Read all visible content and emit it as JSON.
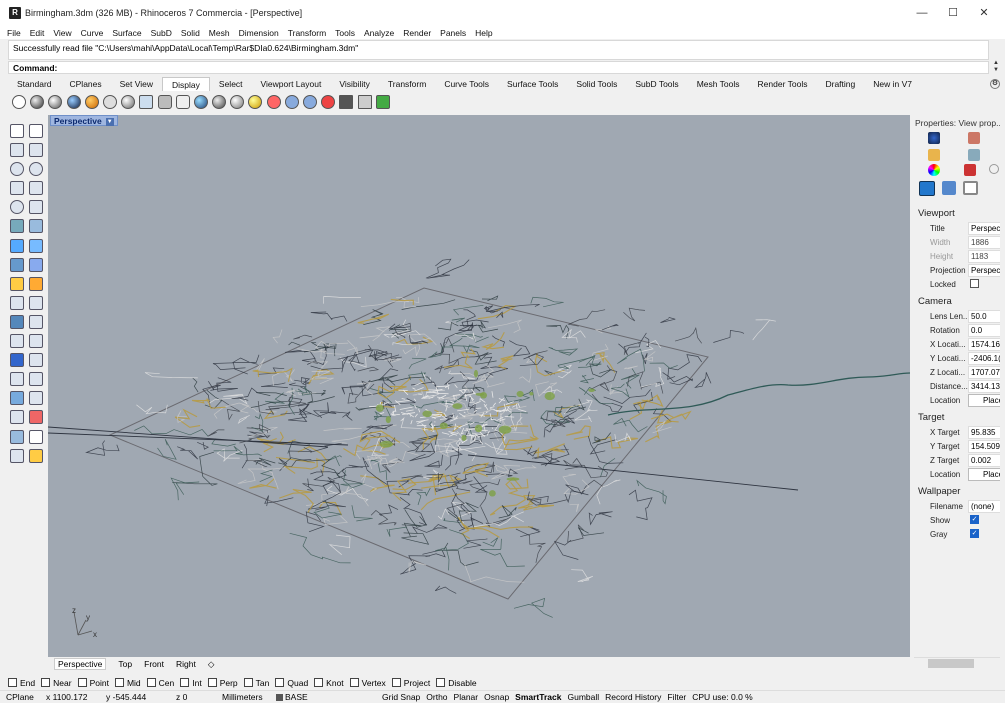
{
  "window": {
    "title": "Birmingham.3dm (326 MB) - Rhinoceros 7 Commercia - [Perspective]",
    "min_icon": "minimize-icon",
    "max_icon": "maximize-icon",
    "close_icon": "close-icon",
    "min": "—",
    "max": "☐",
    "close": "✕"
  },
  "menu": [
    "File",
    "Edit",
    "View",
    "Curve",
    "Surface",
    "SubD",
    "Solid",
    "Mesh",
    "Dimension",
    "Transform",
    "Tools",
    "Analyze",
    "Render",
    "Panels",
    "Help"
  ],
  "command": {
    "history": "Successfully read file \"C:\\Users\\mahi\\AppData\\Local\\Temp\\Rar$DIa0.624\\Birmingham.3dm\"",
    "prompt": "Command:"
  },
  "tabs": [
    "Standard",
    "CPlanes",
    "Set View",
    "Display",
    "Select",
    "Viewport Layout",
    "Visibility",
    "Transform",
    "Curve Tools",
    "Surface Tools",
    "Solid Tools",
    "SubD Tools",
    "Mesh Tools",
    "Render Tools",
    "Drafting",
    "New in V7"
  ],
  "active_tab": "Display",
  "viewport": {
    "title": "Perspective",
    "axis_x": "x",
    "axis_y": "y",
    "axis_z": "z"
  },
  "viewport_tabs": [
    "Perspective",
    "Top",
    "Front",
    "Right"
  ],
  "properties": {
    "title": "Properties: View prop...",
    "viewport_header": "Viewport",
    "camera_header": "Camera",
    "target_header": "Target",
    "wallpaper_header": "Wallpaper",
    "rows_viewport": [
      {
        "label": "Title",
        "value": "Perspect",
        "disabled": false
      },
      {
        "label": "Width",
        "value": "1886",
        "disabled": true
      },
      {
        "label": "Height",
        "value": "1183",
        "disabled": true
      },
      {
        "label": "Projection",
        "value": "Perspect",
        "disabled": false
      }
    ],
    "locked_label": "Locked",
    "rows_camera": [
      {
        "label": "Lens Len...",
        "value": "50.0"
      },
      {
        "label": "Rotation",
        "value": "0.0"
      },
      {
        "label": "X Locati...",
        "value": "1574.16"
      },
      {
        "label": "Y Locati...",
        "value": "-2406.1("
      },
      {
        "label": "Z Locati...",
        "value": "1707.07"
      },
      {
        "label": "Distance...",
        "value": "3414.13"
      }
    ],
    "camera_location_label": "Location",
    "camera_location_button": "Place",
    "rows_target": [
      {
        "label": "X Target",
        "value": "95.835"
      },
      {
        "label": "Y Target",
        "value": "154.509"
      },
      {
        "label": "Z Target",
        "value": "0.002"
      }
    ],
    "target_location_label": "Location",
    "target_location_button": "Place",
    "filename_label": "Filename",
    "filename_value": "(none)",
    "show_label": "Show",
    "gray_label": "Gray"
  },
  "osnaps": [
    "End",
    "Near",
    "Point",
    "Mid",
    "Cen",
    "Int",
    "Perp",
    "Tan",
    "Quad",
    "Knot",
    "Vertex",
    "Project",
    "Disable"
  ],
  "status": {
    "cplane": "CPlane",
    "x": "x 1100.172",
    "y": "y -545.444",
    "z": "z 0",
    "units": "Millimeters",
    "layer": "BASE",
    "grid_snap": "Grid Snap",
    "ortho": "Ortho",
    "planar": "Planar",
    "osnap": "Osnap",
    "smarttrack": "SmartTrack",
    "gumball": "Gumball",
    "record_history": "Record History",
    "filter": "Filter",
    "cpu": "CPU use: 0.0 %"
  }
}
